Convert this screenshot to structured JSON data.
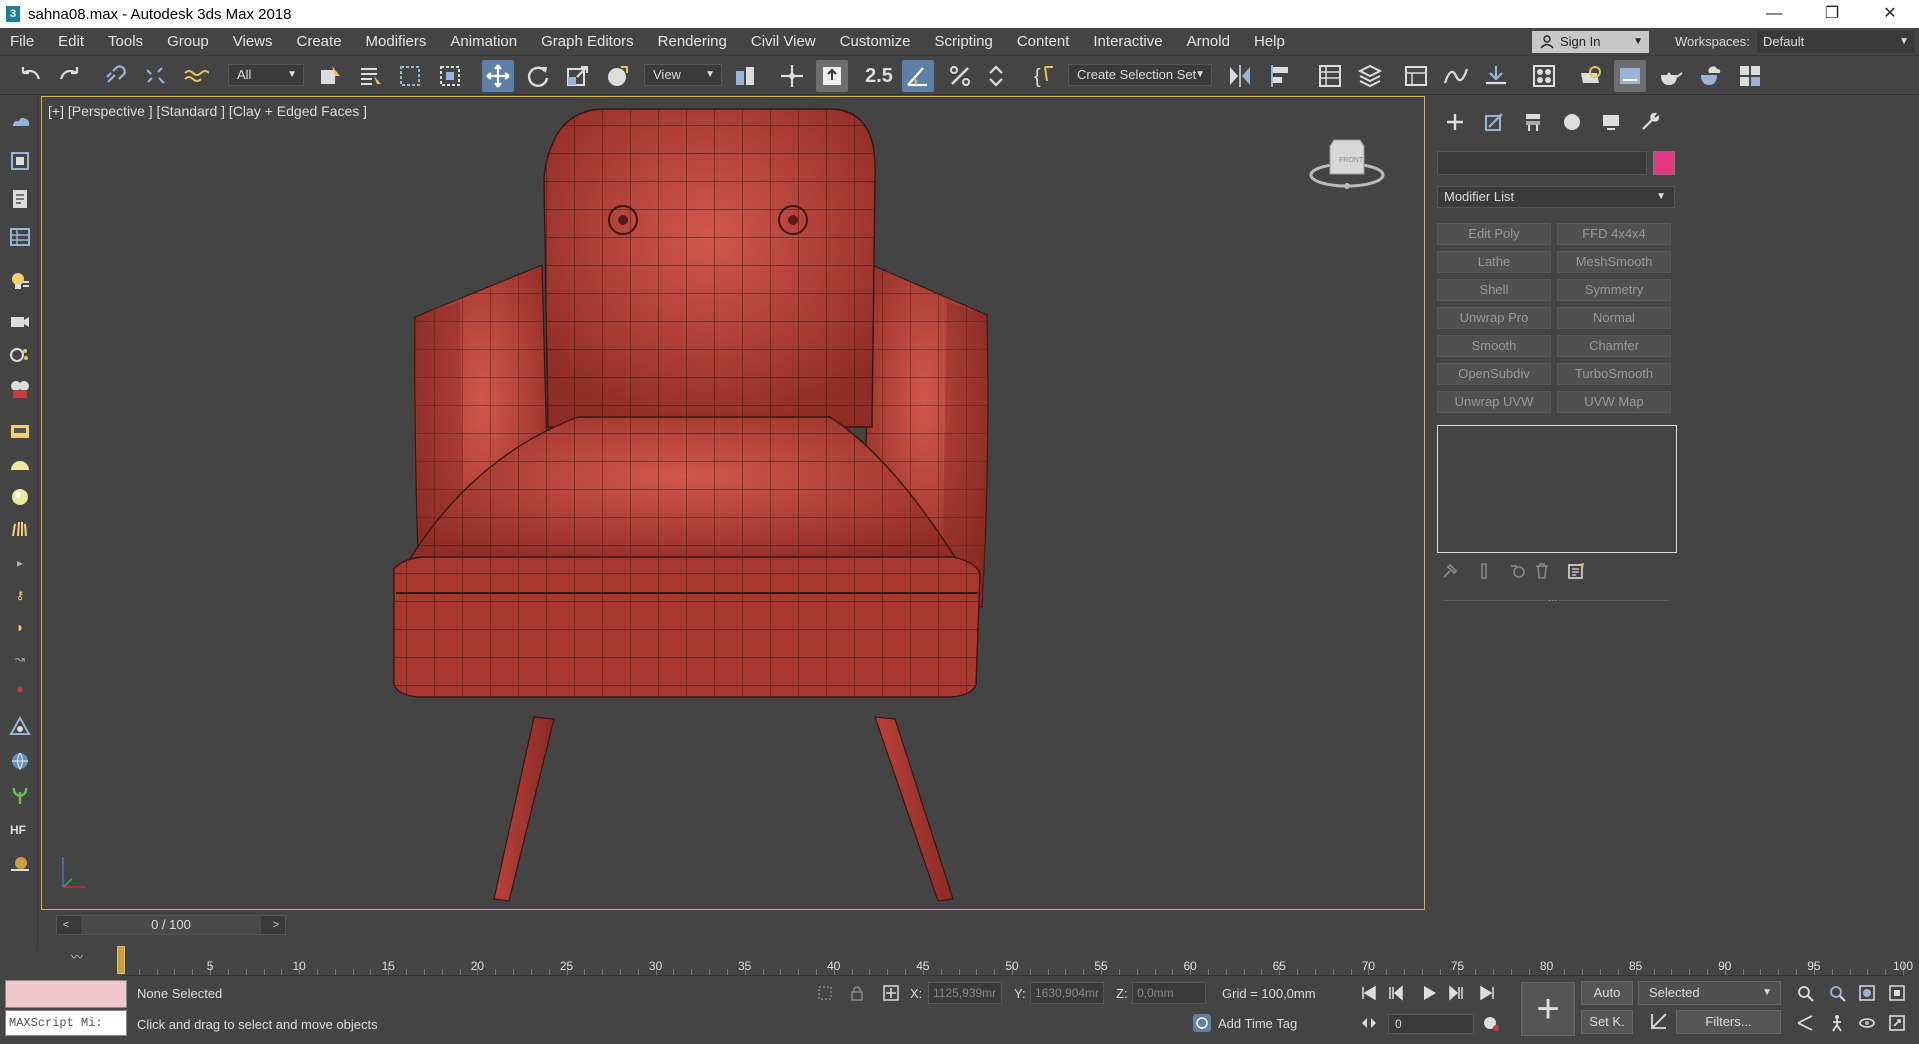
{
  "window": {
    "title": "sahna08.max - Autodesk 3ds Max 2018",
    "app_icon": "3",
    "minimize": "—",
    "restore": "❐",
    "close": "✕"
  },
  "menu": [
    "File",
    "Edit",
    "Tools",
    "Group",
    "Views",
    "Create",
    "Modifiers",
    "Animation",
    "Graph Editors",
    "Rendering",
    "Civil View",
    "Customize",
    "Scripting",
    "Content",
    "Interactive",
    "Arnold",
    "Help"
  ],
  "account": {
    "sign_in": "Sign In",
    "workspaces_label": "Workspaces:",
    "workspace": "Default"
  },
  "toolbar": {
    "selection_filter": "All",
    "ref_coord": "View",
    "snap_label": "2.5",
    "named_selection": "Create Selection Set"
  },
  "viewport": {
    "label": "[+] [Perspective ] [Standard ] [Clay + Edged Faces ]",
    "viewcube_text": "FRONT",
    "model_color": "#b8413a"
  },
  "command_panel": {
    "object_name": "",
    "object_color": "#e0377f",
    "modifier_list": "Modifier List",
    "modifier_buttons": [
      "Edit Poly",
      "FFD 4x4x4",
      "Lathe",
      "MeshSmooth",
      "Shell",
      "Symmetry",
      "Unwrap Pro",
      "Normal",
      "Smooth",
      "Chamfer",
      "OpenSubdiv",
      "TurboSmooth",
      "Unwrap UVW",
      "UVW Map"
    ]
  },
  "timeline": {
    "slider": "0 / 100",
    "ticks": [
      "5",
      "10",
      "15",
      "20",
      "25",
      "30",
      "35",
      "40",
      "45",
      "50",
      "55",
      "60",
      "65",
      "70",
      "75",
      "80",
      "85",
      "90",
      "95",
      "100"
    ],
    "current_frame": 0,
    "max_frame": 100
  },
  "status": {
    "maxscript": "MAXScript Mi:",
    "selection": "None Selected",
    "prompt": "Click and drag to select and move objects",
    "x_label": "X:",
    "x": "1125,939mr",
    "y_label": "Y:",
    "y": "1630,904mr",
    "z_label": "Z:",
    "z": "0,0mm",
    "grid": "Grid = 100,0mm",
    "add_time_tag": "Add Time Tag",
    "frame": "0",
    "auto": "Auto",
    "selected": "Selected",
    "set_key": "Set K.",
    "filters": "Filters..."
  }
}
